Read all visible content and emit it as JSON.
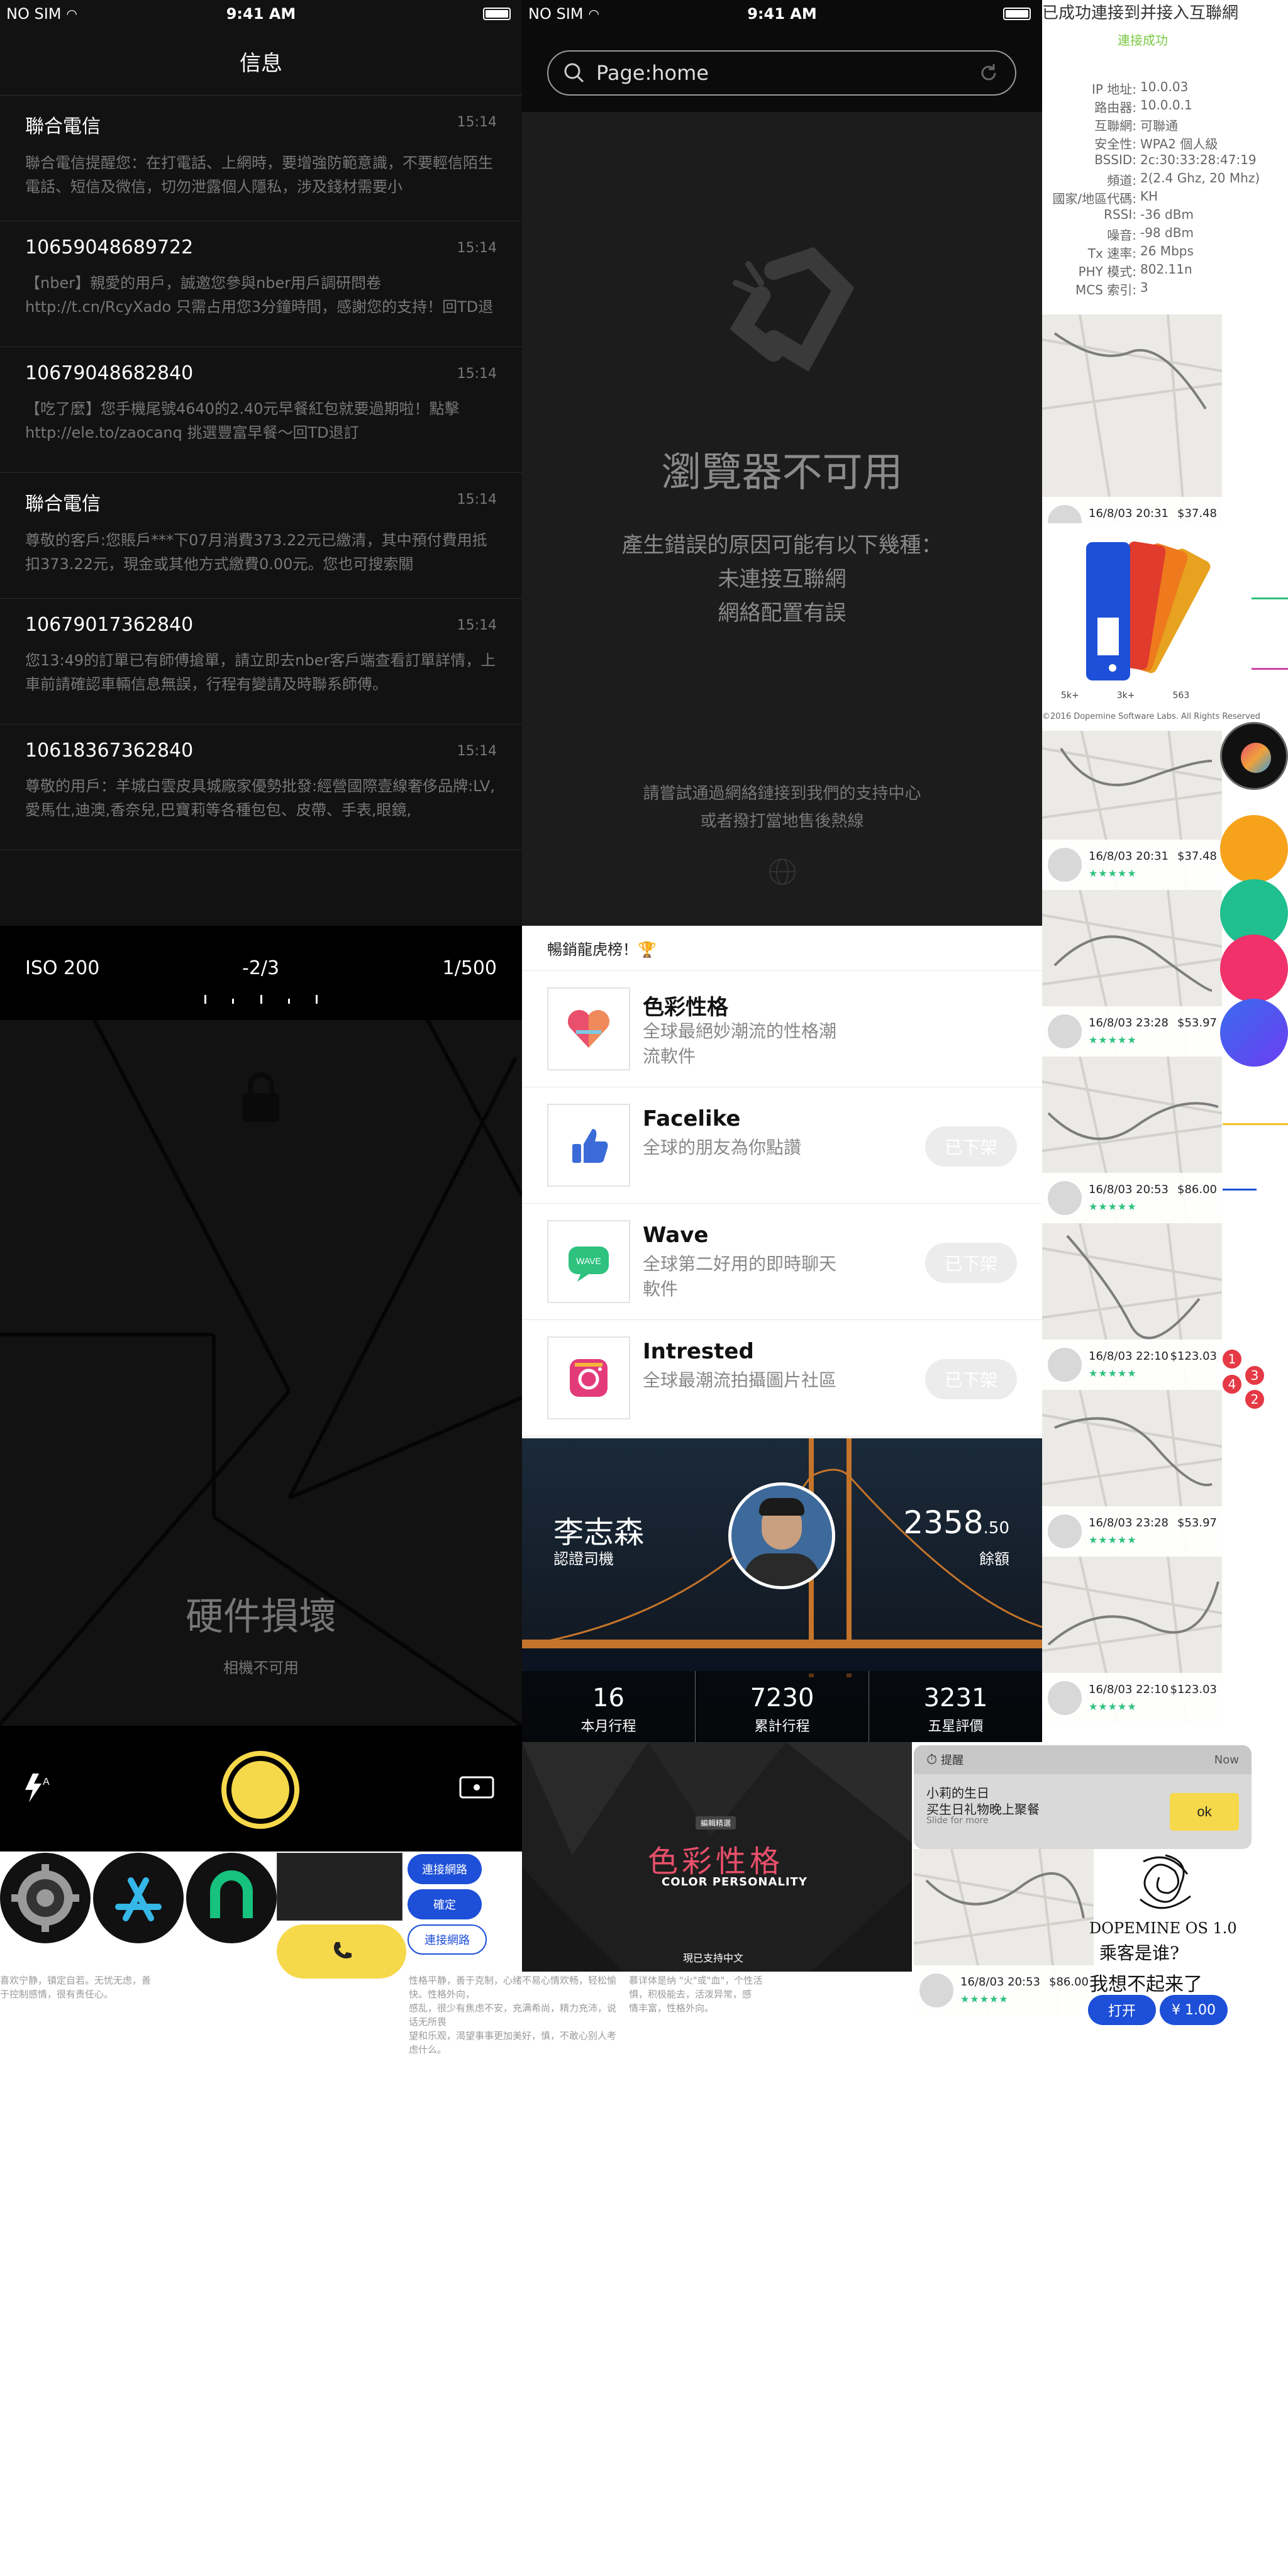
{
  "status": {
    "carrier": "NO SIM",
    "time": "9:41 AM"
  },
  "messages": {
    "title": "信息",
    "items": [
      {
        "sender": "聯合電信",
        "time": "15:14",
        "body": "聯合電信提醒您：在打電話、上網時，要增強防範意識，不要輕信陌生電話、短信及微信，切勿泄露個人隱私，涉及錢材需要小"
      },
      {
        "sender": "10659048689722",
        "time": "15:14",
        "body": "【nber】親愛的用戶，誠邀您參與nber用戶調研問卷 http://t.cn/RcyXado 只需占用您3分鐘時間，感謝您的支持！回TD退訂"
      },
      {
        "sender": "10679048682840",
        "time": "15:14",
        "body": "【吃了麼】您手機尾號4640的2.40元早餐紅包就要過期啦！點擊 http://ele.to/zaocanq 挑選豐富早餐～回TD退訂"
      },
      {
        "sender": "聯合電信",
        "time": "15:14",
        "body": "尊敬的客戶:您賬戶***下07月消費373.22元已繳清，其中預付費用抵扣373.22元，現金或其他方式繳費0.00元。您也可搜索關"
      },
      {
        "sender": "10679017362840",
        "time": "15:14",
        "body": "您13:49的訂單已有師傅搶單，請立即去nber客戶端查看訂單詳情，上車前請確認車輛信息無誤，行程有變請及時聯系師傅。"
      },
      {
        "sender": "10618367362840",
        "time": "15:14",
        "body": "尊敬的用戶：羊城白雲皮具城廠家優勢批發:經營國際壹線奢侈品牌:LV,愛馬仕,迪澳,香奈兒,巴寶莉等各種包包、皮帶、手表,眼鏡,"
      }
    ]
  },
  "browser": {
    "url": "Page:home",
    "title": "瀏覽器不可用",
    "reasons": [
      "產生錯誤的原因可能有以下幾種：",
      "未連接互聯網",
      "網絡配置有誤"
    ],
    "hint": [
      "請嘗試通過網絡鏈接到我們的支持中心",
      "或者撥打當地售後熱線"
    ]
  },
  "wifi": {
    "title": "已成功連接到并接入互聯網",
    "subtitle": "連接成功",
    "rows": [
      {
        "k": "IP 地址:",
        "v": "10.0.03"
      },
      {
        "k": "路由器:",
        "v": "10.0.0.1"
      },
      {
        "k": "互聯網:",
        "v": "可聯通"
      },
      {
        "k": "安全性:",
        "v": "WPA2 個人級"
      },
      {
        "k": "BSSID:",
        "v": "2c:30:33:28:47:19"
      },
      {
        "k": "頻道:",
        "v": "2(2.4 Ghz, 20 Mhz)"
      },
      {
        "k": "國家/地區代碼:",
        "v": "KH"
      },
      {
        "k": "RSSI:",
        "v": "-36 dBm"
      },
      {
        "k": "噪音:",
        "v": "-98 dBm"
      },
      {
        "k": "Tx 速率:",
        "v": "26 Mbps"
      },
      {
        "k": "PHY 模式:",
        "v": "802.11n"
      },
      {
        "k": "MCS 索引:",
        "v": "3"
      }
    ]
  },
  "maps": [
    {
      "date": "16/8/03 20:31",
      "price": "$37.48",
      "stars": "★★★★★"
    },
    {
      "date": "16/8/03 20:31",
      "price": "$37.48",
      "stars": "★★★★★"
    },
    {
      "date": "16/8/03 23:28",
      "price": "$53.97",
      "stars": "★★★★★"
    },
    {
      "date": "16/8/03 20:53",
      "price": "$86.00",
      "stars": "★★★★★"
    },
    {
      "date": "16/8/03 22:10",
      "price": "$123.03",
      "stars": "★★★★★"
    },
    {
      "date": "16/8/03 23:28",
      "price": "$53.97",
      "stars": "★★★★★"
    },
    {
      "date": "16/8/03 22:10",
      "price": "$123.03",
      "stars": "★★★★★"
    },
    {
      "date": "16/8/03 20:53",
      "price": "$86.00",
      "stars": "★★★★★"
    }
  ],
  "palette": {
    "footer": "©2016 Dopemine Software Labs. All Rights Reserved",
    "stats": [
      "5k+",
      "3k+",
      "563"
    ]
  },
  "badges": [
    "1",
    "3",
    "4",
    "2"
  ],
  "camera": {
    "iso": "ISO 200",
    "ev": "-2/3",
    "shutter": "1/500",
    "title": "硬件損壞",
    "subtitle": "相機不可用"
  },
  "store": {
    "heading": "暢銷龍虎榜！🏆",
    "apps": [
      {
        "name": "色彩性格",
        "desc": "全球最絕妙潮流的性格潮流軟件",
        "button": ""
      },
      {
        "name": "Facelike",
        "desc": "全球的朋友為你點讚",
        "button": "已下架"
      },
      {
        "name": "Wave",
        "desc": "全球第二好用的即時聊天軟件",
        "button": "已下架"
      },
      {
        "name": "Intrested",
        "desc": "全球最潮流拍攝圖片社區",
        "button": "已下架"
      }
    ]
  },
  "driver": {
    "name": "李志森",
    "role": "認證司機",
    "balance_main": "2358",
    "balance_dec": ".50",
    "balance_label": "餘額",
    "stats": [
      {
        "n": "16",
        "l": "本月行程"
      },
      {
        "n": "7230",
        "l": "累計行程"
      },
      {
        "n": "3231",
        "l": "五星評價"
      }
    ]
  },
  "color_banner": {
    "tag": "編輯精選",
    "title": "色彩性格",
    "subtitle": "COLOR PERSONALITY",
    "footer": "現已支持中文"
  },
  "notification": {
    "app": "提醒",
    "time": "Now",
    "title": "小莉的生日",
    "body": "买生日礼物晚上聚餐",
    "hint": "Slide for more",
    "action": "ok"
  },
  "buttons": {
    "connect": "連接網路",
    "confirm": "確定",
    "connect2": "連接網路"
  },
  "dopemine": {
    "title": "DOPEMINE OS 1.0",
    "line1": "乘客是谁?",
    "line2": "我想不起来了",
    "open": "打开",
    "price": "¥ 1.00"
  },
  "fine_text": {
    "left": "喜欢宁静，镇定自若。无忧无虑，善于控制感情，很有责任心。",
    "mid1": "性格平静，善于克制，心绪不易心情欢畅，轻松愉快。性格外向，",
    "mid2": "感乱，很少有焦虑不安，充满希尚，精力充沛，说话无所畏",
    "mid3": "望和乐观，渴望事事更加美好，慎，不敢心别人考虑什么。",
    "right1": "慕详体是纳 \"火\"或\"血\"，个性活",
    "right2": "惧，积极能去，活泼异常，感",
    "right3": "情丰富，性格外向。"
  },
  "colors": {
    "accent_yellow": "#f6d84b",
    "accent_blue": "#1d4fd8",
    "green": "#2ec27e",
    "badge_red": "#e53945"
  }
}
